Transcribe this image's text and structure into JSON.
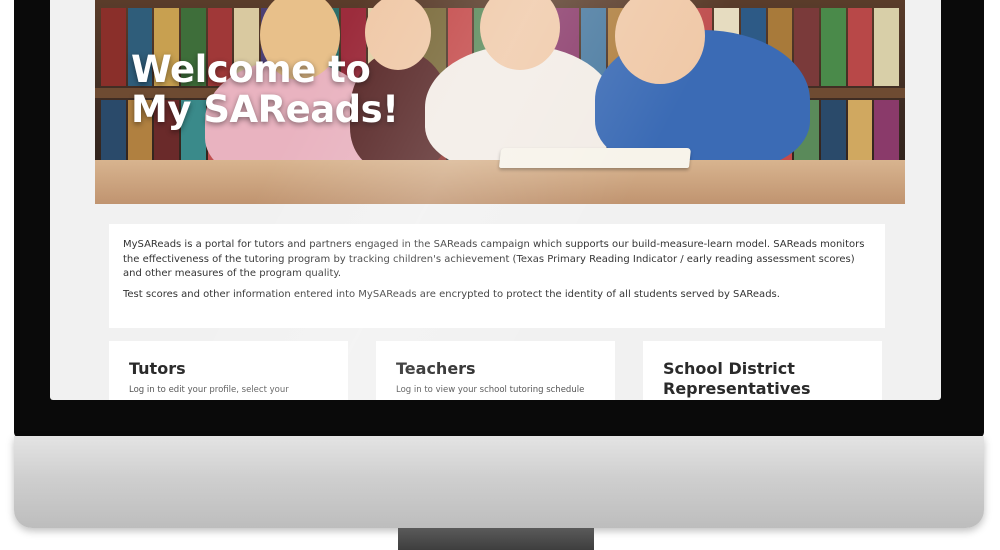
{
  "hero": {
    "title_line1": "Welcome to",
    "title_line2": "My SAReads!"
  },
  "intro": {
    "paragraph1": "MySAReads is a portal for tutors and partners engaged in the SAReads campaign which supports our build-measure-learn model. SAReads monitors the effectiveness of the tutoring program by tracking children's achievement (Texas Primary Reading Indicator / early reading assessment scores) and other measures of the program quality.",
    "paragraph2": "Test scores and other information entered into MySAReads are encrypted to protect the identity of all students served by SAReads."
  },
  "cards": [
    {
      "title": "Tutors",
      "description": "Log in to edit your profile, select your"
    },
    {
      "title": "Teachers",
      "description": "Log in to view your school tutoring schedule"
    },
    {
      "title": "School District Representatives",
      "description": ""
    }
  ],
  "colors": {
    "page_background": "#f1f1f1",
    "bezel": "#0a0a0a",
    "card_background": "#ffffff"
  }
}
